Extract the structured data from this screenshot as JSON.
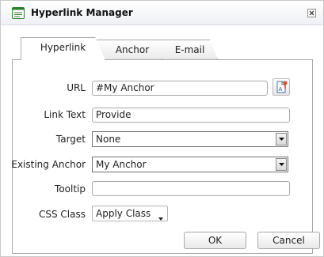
{
  "dialog": {
    "title": "Hyperlink Manager",
    "app_icon": "hyperlink-manager-icon",
    "close_icon": "close-icon"
  },
  "tabs": [
    {
      "label": "Hyperlink",
      "active": true
    },
    {
      "label": "Anchor",
      "active": false
    },
    {
      "label": "E-mail",
      "active": false
    }
  ],
  "form": {
    "url": {
      "label": "URL",
      "value": "#My Anchor",
      "picker_icon": "document-picker-icon"
    },
    "link_text": {
      "label": "Link Text",
      "value": "Provide"
    },
    "target": {
      "label": "Target",
      "value": "None"
    },
    "existing_anchor": {
      "label": "Existing Anchor",
      "value": "My Anchor"
    },
    "tooltip": {
      "label": "Tooltip",
      "value": ""
    },
    "css_class": {
      "label": "CSS Class",
      "value": "Apply Class"
    }
  },
  "buttons": {
    "ok": "OK",
    "cancel": "Cancel"
  },
  "colors": {
    "panel_border": "#a8a8a8",
    "titlebar_bg": "#eef1f5"
  }
}
